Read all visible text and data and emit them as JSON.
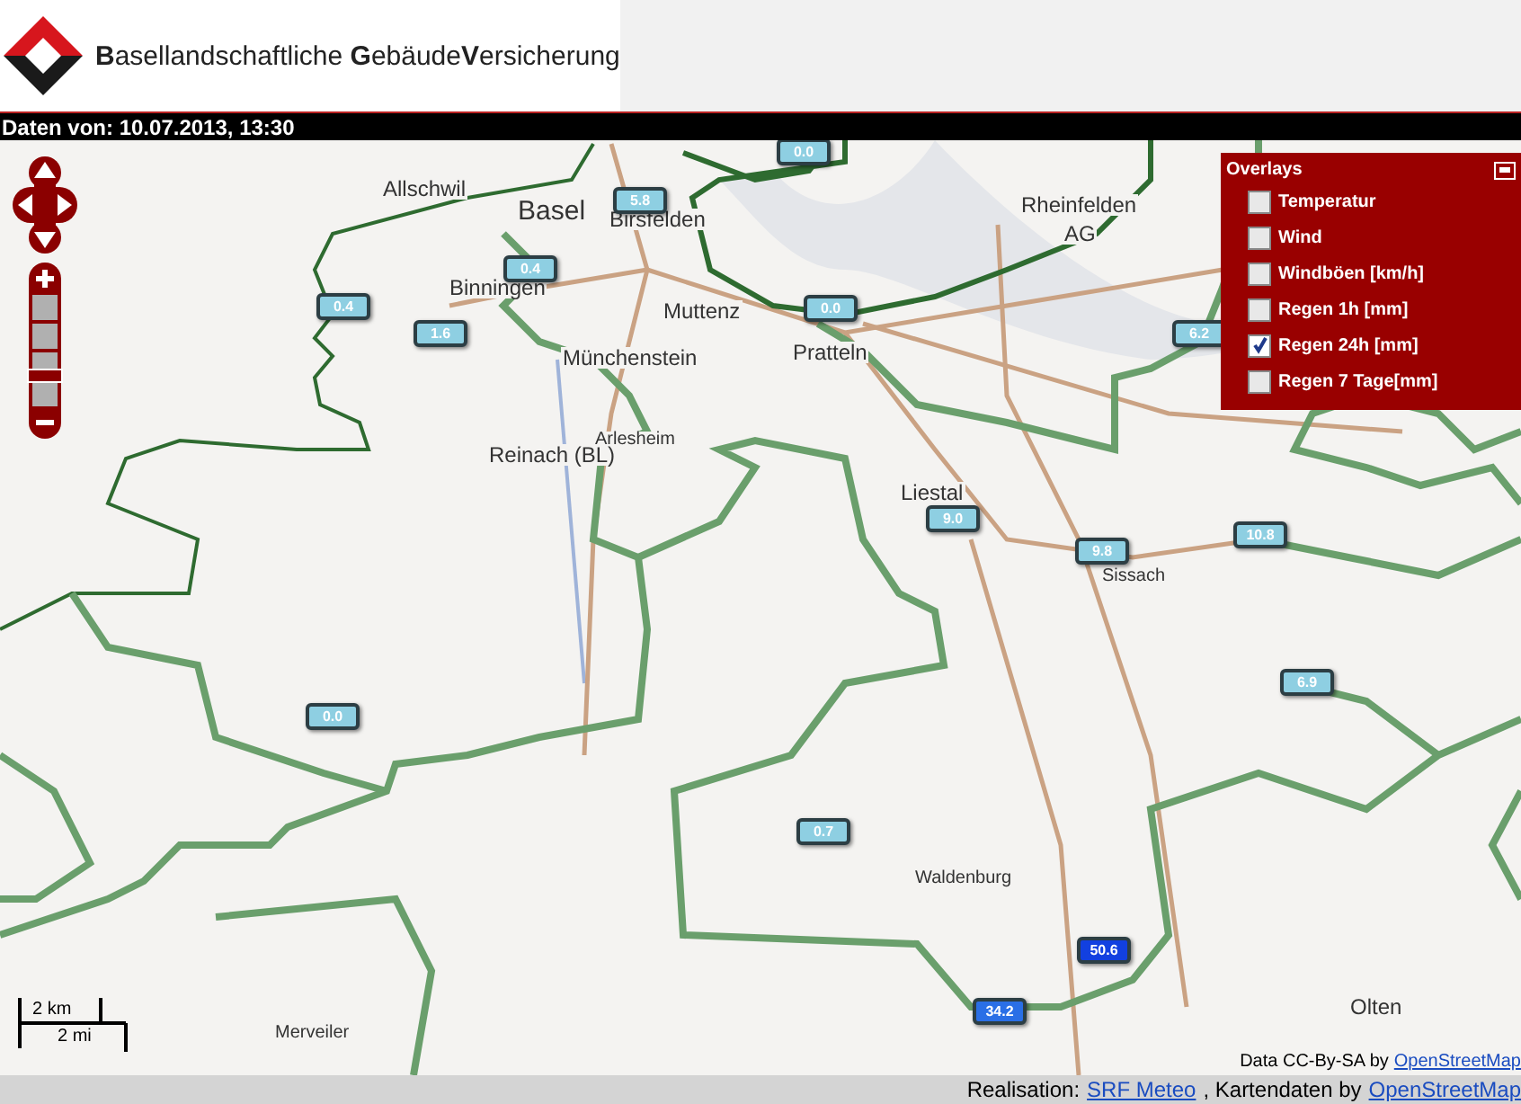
{
  "header": {
    "logo_text": "**B**asellandschaftliche **G**ebäude**V**ersicherung"
  },
  "date_bar": {
    "text": "Daten von: 10.07.2013, 13:30"
  },
  "map": {
    "zoom_slider": {
      "level": 0.3
    },
    "places": [
      {
        "name": "Allschwil",
        "kind": "town"
      },
      {
        "name": "Basel",
        "kind": "city"
      },
      {
        "name": "Birsfelden",
        "kind": "town"
      },
      {
        "name": "Binningen",
        "kind": "town"
      },
      {
        "name": "Muttenz",
        "kind": "town"
      },
      {
        "name": "Münchenstein",
        "kind": "town"
      },
      {
        "name": "Pratteln",
        "kind": "town"
      },
      {
        "name": "Rheinfelden",
        "kind": "town"
      },
      {
        "name": "AG",
        "kind": "town"
      },
      {
        "name": "Arlesheim",
        "kind": "village"
      },
      {
        "name": "Reinach (BL)",
        "kind": "town"
      },
      {
        "name": "Liestal",
        "kind": "town"
      },
      {
        "name": "Sissach",
        "kind": "village"
      },
      {
        "name": "Waldenburg",
        "kind": "village"
      },
      {
        "name": "Olten",
        "kind": "town"
      },
      {
        "name": "Merveiler",
        "kind": "village"
      }
    ],
    "markers": [
      {
        "value": "0.0",
        "color": "#8ecfe2"
      },
      {
        "value": "5.8",
        "color": "#8ecfe2"
      },
      {
        "value": "0.4",
        "color": "#8ecfe2"
      },
      {
        "value": "0.4",
        "color": "#8ecfe2"
      },
      {
        "value": "1.6",
        "color": "#8ecfe2"
      },
      {
        "value": "0.0",
        "color": "#8ecfe2"
      },
      {
        "value": "6.2",
        "color": "#8ecfe2"
      },
      {
        "value": "9.0",
        "color": "#8ecfe2"
      },
      {
        "value": "9.8",
        "color": "#8ecfe2"
      },
      {
        "value": "10.8",
        "color": "#8ecfe2"
      },
      {
        "value": "6.9",
        "color": "#8ecfe2"
      },
      {
        "value": "0.0",
        "color": "#8ecfe2"
      },
      {
        "value": "0.7",
        "color": "#8ecfe2"
      },
      {
        "value": "50.6",
        "color": "#1240e0"
      },
      {
        "value": "34.2",
        "color": "#2a6fe6"
      }
    ],
    "scale": {
      "metric": "2 km",
      "imperial": "2 mi"
    },
    "attribution": {
      "text": "Data CC-By-SA by",
      "link": "OpenStreetMap"
    }
  },
  "overlays": {
    "title": "Overlays",
    "items": [
      {
        "label": "Temperatur",
        "checked": false
      },
      {
        "label": "Wind",
        "checked": false
      },
      {
        "label": "Windböen [km/h]",
        "checked": false
      },
      {
        "label": "Regen 1h [mm]",
        "checked": false
      },
      {
        "label": "Regen 24h [mm]",
        "checked": true
      },
      {
        "label": "Regen 7 Tage[mm]",
        "checked": false
      }
    ]
  },
  "footer": {
    "prefix": "Realisation:",
    "link_1": "SRF Meteo",
    "middle": ", Kartendaten by",
    "link_2": "OpenStreetMap"
  }
}
